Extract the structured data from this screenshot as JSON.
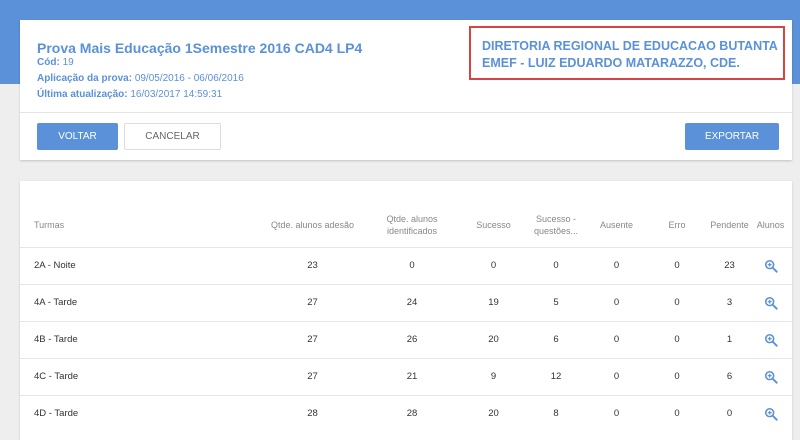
{
  "header": {
    "title": "Prova Mais Educação 1Semestre 2016 CAD4 LP4",
    "cod_label": "Cód:",
    "cod_value": "19",
    "aplicacao_label": "Aplicação da prova:",
    "aplicacao_value": "09/05/2016 - 06/06/2016",
    "atualizacao_label": "Última atualização:",
    "atualizacao_value": "16/03/2017 14:59:31",
    "school_line1": "DIRETORIA REGIONAL DE EDUCACAO BUTANTA",
    "school_line2": "EMEF - LUIZ EDUARDO MATARAZZO, CDE."
  },
  "buttons": {
    "voltar": "VOLTAR",
    "cancelar": "CANCELAR",
    "exportar": "EXPORTAR"
  },
  "table": {
    "columns": {
      "turmas": "Turmas",
      "adesao": "Qtde. alunos adesão",
      "identificados": "Qtde. alunos identificados",
      "sucesso": "Sucesso",
      "sucesso_questoes": "Sucesso - questões...",
      "ausente": "Ausente",
      "erro": "Erro",
      "pendente": "Pendente",
      "alunos": "Alunos"
    },
    "rows": [
      {
        "turma": "2A - Noite",
        "adesao": "23",
        "identificados": "0",
        "sucesso": "0",
        "sucesso_questoes": "0",
        "ausente": "0",
        "erro": "0",
        "pendente": "23"
      },
      {
        "turma": "4A - Tarde",
        "adesao": "27",
        "identificados": "24",
        "sucesso": "19",
        "sucesso_questoes": "5",
        "ausente": "0",
        "erro": "0",
        "pendente": "3"
      },
      {
        "turma": "4B - Tarde",
        "adesao": "27",
        "identificados": "26",
        "sucesso": "20",
        "sucesso_questoes": "6",
        "ausente": "0",
        "erro": "0",
        "pendente": "1"
      },
      {
        "turma": "4C - Tarde",
        "adesao": "27",
        "identificados": "21",
        "sucesso": "9",
        "sucesso_questoes": "12",
        "ausente": "0",
        "erro": "0",
        "pendente": "6"
      },
      {
        "turma": "4D - Tarde",
        "adesao": "28",
        "identificados": "28",
        "sucesso": "20",
        "sucesso_questoes": "8",
        "ausente": "0",
        "erro": "0",
        "pendente": "0"
      }
    ]
  },
  "colors": {
    "accent": "#5a91d8",
    "highlight_border": "#d64545"
  },
  "icons": {
    "alunos_action": "zoom-in-icon"
  }
}
